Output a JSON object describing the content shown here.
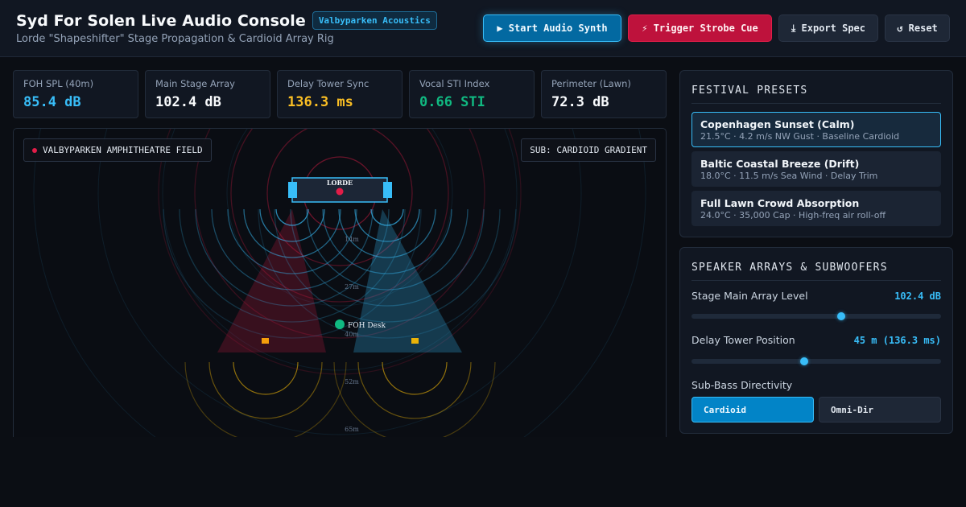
{
  "header": {
    "title": "Syd For Solen Live Audio Console",
    "badge": "Valbyparken Acoustics",
    "subtitle": "Lorde \"Shapeshifter\" Stage Propagation & Cardioid Array Rig",
    "buttons": {
      "synth": "▶ Start Audio Synth",
      "strobe": "⚡ Trigger Strobe Cue",
      "export": "⤓ Export Spec",
      "reset": "↺ Reset"
    }
  },
  "metrics": [
    {
      "label": "FOH SPL (40m)",
      "value": "85.4 dB",
      "color": "#38bdf8"
    },
    {
      "label": "Main Stage Array",
      "value": "102.4 dB",
      "color": "#f8fafc"
    },
    {
      "label": "Delay Tower Sync",
      "value": "136.3 ms",
      "color": "#fbbf24"
    },
    {
      "label": "Vocal STI Index",
      "value": "0.66 STI",
      "color": "#10b981"
    },
    {
      "label": "Perimeter (Lawn)",
      "value": "72.3 dB",
      "color": "#f8fafc"
    }
  ],
  "map": {
    "venue_label": "VALBYPARKEN AMPHITHEATRE FIELD",
    "sub_label": "SUB: CARDIOID GRADIENT",
    "stage_label": "LORDE",
    "foh_label": "FOH Desk",
    "distance_labels": [
      "14m",
      "27m",
      "40m",
      "52m",
      "65m"
    ],
    "colors": {
      "blue": "#38bdf8",
      "red": "#e11d48",
      "yellow": "#eab308",
      "orange": "#f59e0b",
      "green": "#10b981"
    }
  },
  "presets": {
    "title": "FESTIVAL PRESETS",
    "items": [
      {
        "name": "Copenhagen Sunset (Calm)",
        "meta": "21.5°C · 4.2 m/s NW Gust · Baseline Cardioid",
        "active": true
      },
      {
        "name": "Baltic Coastal Breeze (Drift)",
        "meta": "18.0°C · 11.5 m/s Sea Wind · Delay Trim",
        "active": false
      },
      {
        "name": "Full Lawn Crowd Absorption",
        "meta": "24.0°C · 35,000 Cap · High-freq air roll-off",
        "active": false
      }
    ]
  },
  "arrays": {
    "title": "SPEAKER ARRAYS & SUBWOOFERS",
    "main_level": {
      "label": "Stage Main Array Level",
      "value": "102.4 dB",
      "level": 0.6
    },
    "delay_position": {
      "label": "Delay Tower Position",
      "value": "45 m (136.3 ms)",
      "level": 0.45
    },
    "sub": {
      "label": "Sub-Bass Directivity",
      "options": [
        "Cardioid",
        "Omni-Dir"
      ],
      "selected": "Cardioid"
    }
  }
}
